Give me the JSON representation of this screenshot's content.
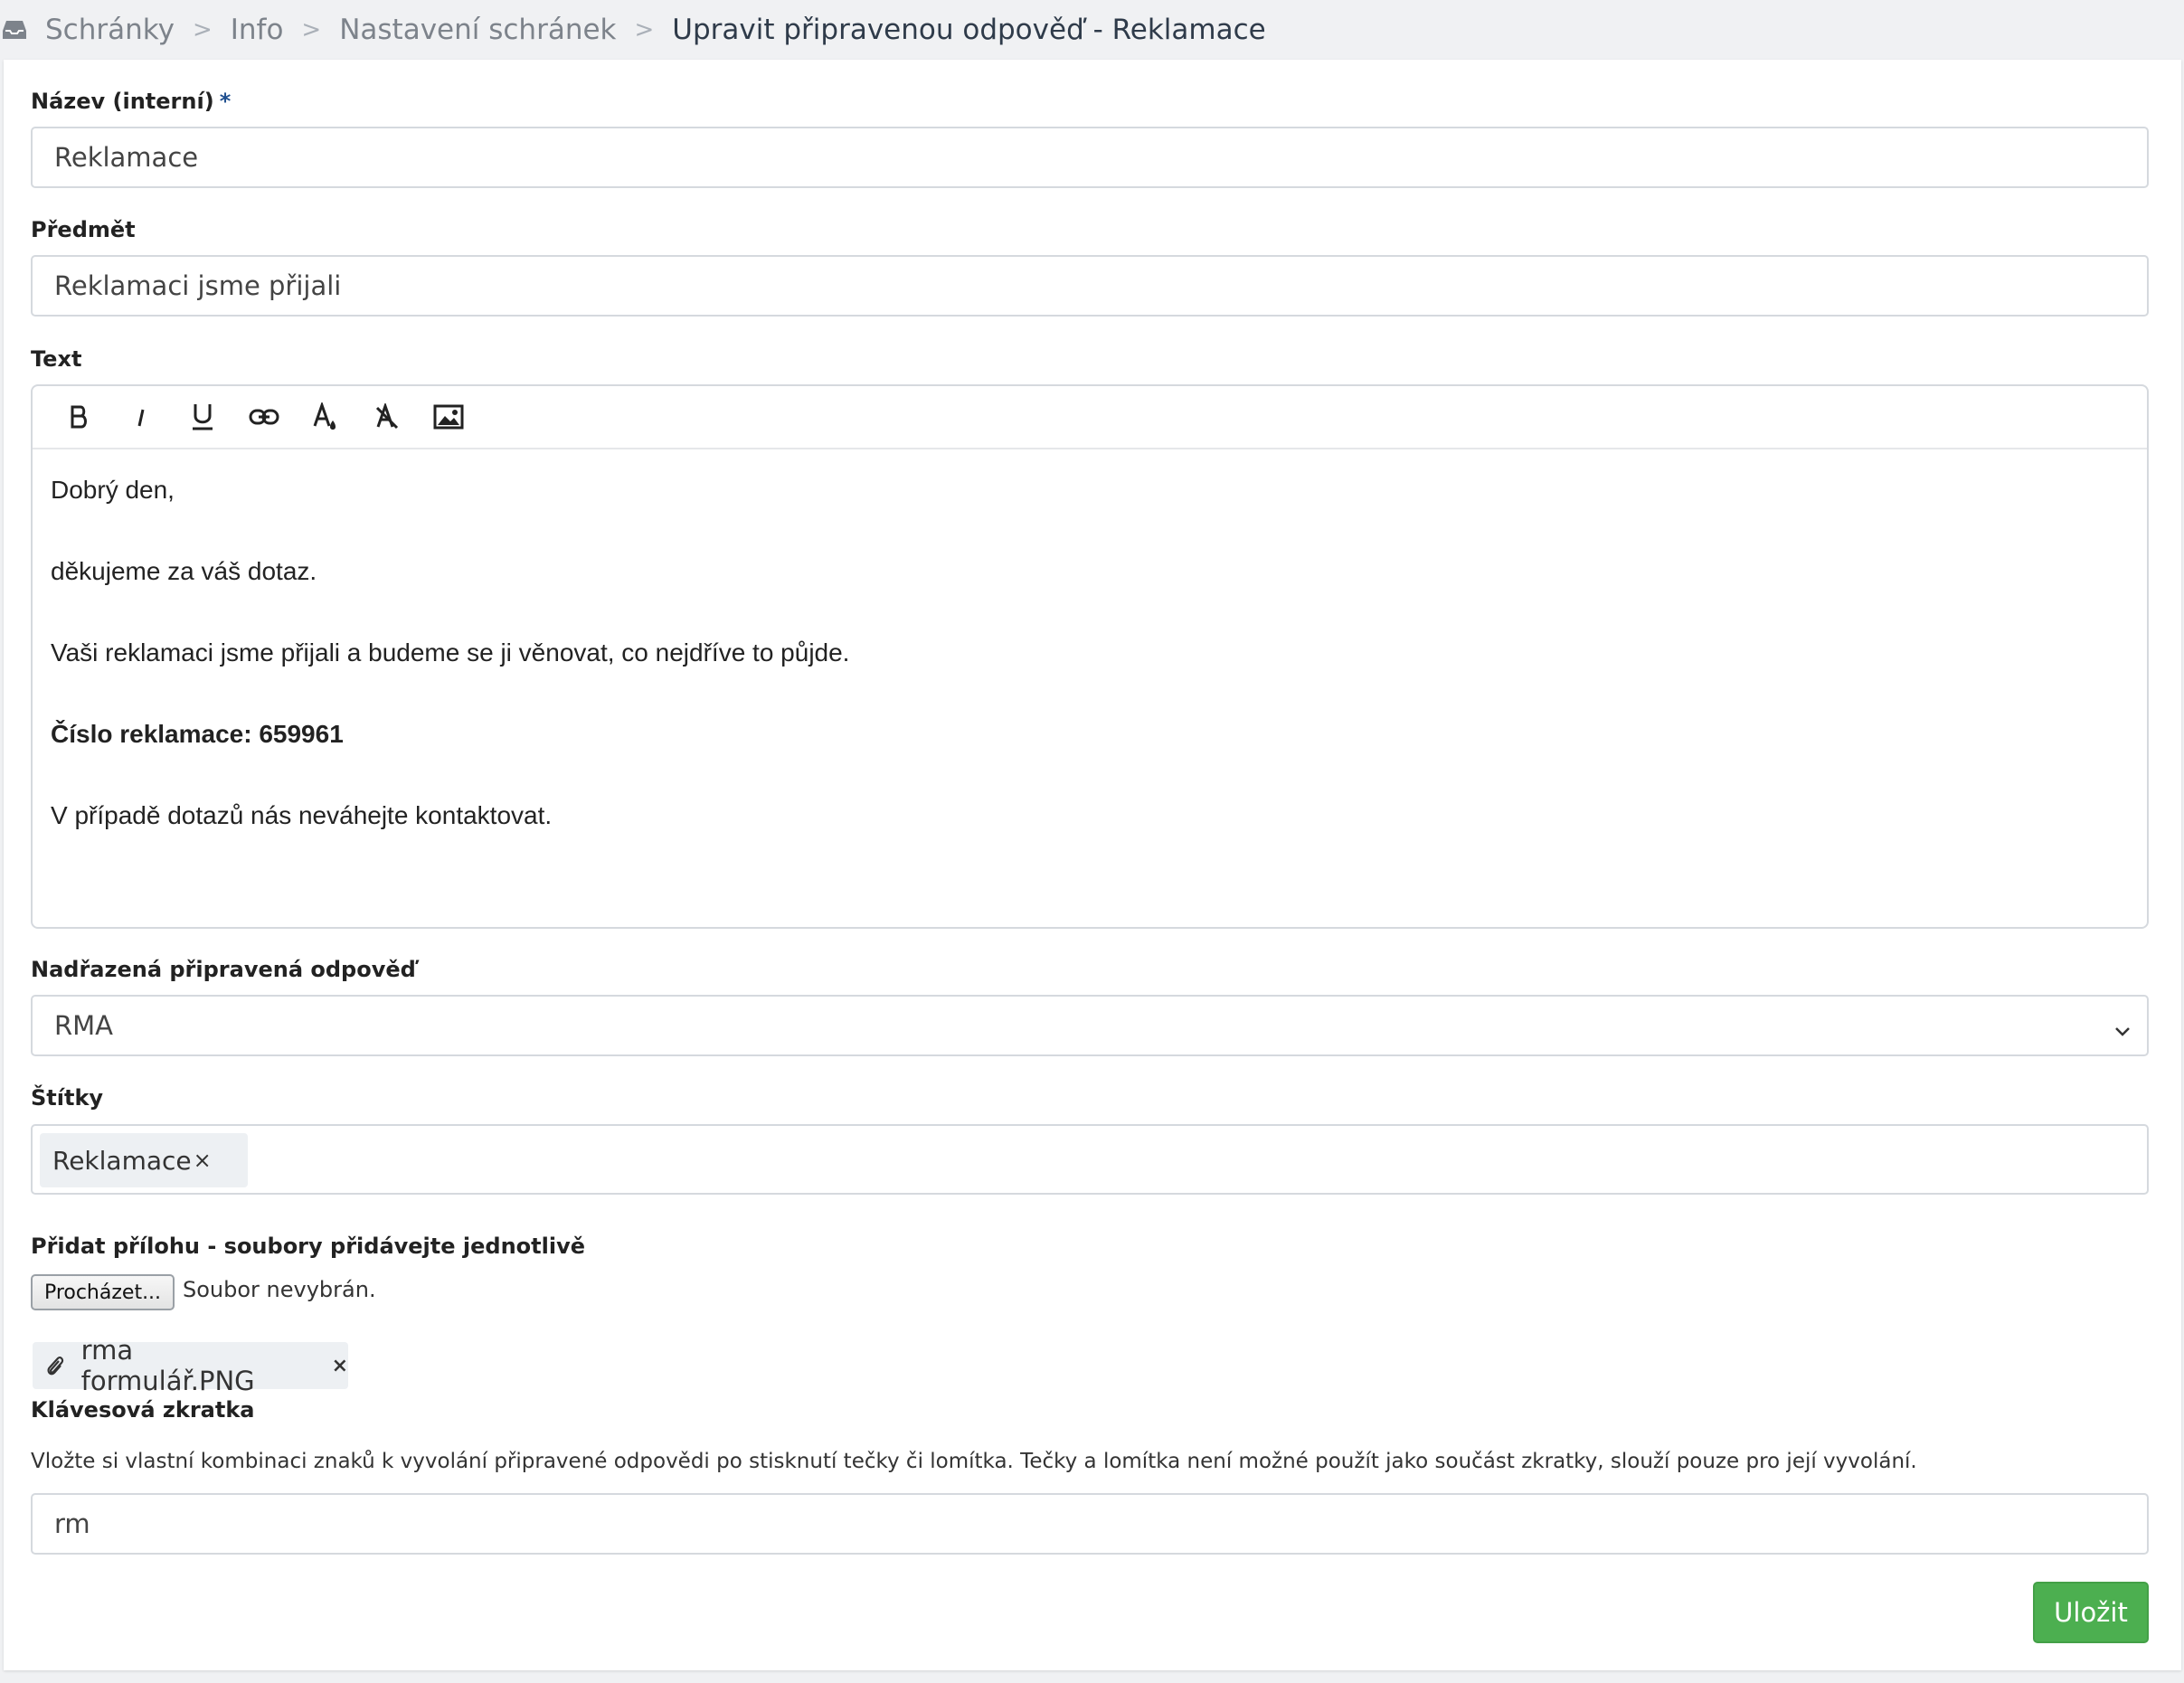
{
  "breadcrumb": {
    "icon": "inbox-icon",
    "items": [
      "Schránky",
      "Info",
      "Nastavení schránek"
    ],
    "separator": ">",
    "current": "Upravit připravenou odpověď - Reklamace"
  },
  "form": {
    "name": {
      "label": "Název (interní)",
      "required_mark": "*",
      "value": "Reklamace"
    },
    "subject": {
      "label": "Předmět",
      "value": "Reklamaci jsme přijali"
    },
    "text": {
      "label": "Text",
      "toolbar": [
        "bold-icon",
        "italic-icon",
        "underline-icon",
        "link-icon",
        "text-color-icon",
        "clear-format-icon",
        "image-icon"
      ],
      "body": [
        "Dobrý den,",
        "děkujeme za váš dotaz.",
        "Vaši reklamaci jsme přijali a budeme se ji věnovat, co nejdříve to půjde.",
        "Číslo reklamace: 659961",
        "V případě dotazů nás neváhejte kontaktovat."
      ]
    },
    "parent": {
      "label": "Nadřazená připravená odpověď",
      "value": "RMA"
    },
    "tags": {
      "label": "Štítky",
      "items": [
        "Reklamace"
      ],
      "remove": "×"
    },
    "attachment": {
      "label": "Přidat přílohu - soubory přidávejte jednotlivě",
      "browse_label": "Procházet...",
      "status": "Soubor nevybrán.",
      "files": [
        "rma formulář.PNG"
      ],
      "remove": "×"
    },
    "shortcut": {
      "label": "Klávesová zkratka",
      "help": "Vložte si vlastní kombinaci znaků k vyvolání připravené odpovědi po stisknutí tečky či lomítka. Tečky a lomítka není možné použít jako součást zkratky, slouží pouze pro její vyvolání.",
      "value": "rm"
    },
    "save_label": "Uložit"
  },
  "colors": {
    "accent": "#4caf50",
    "required": "#1f4f8f"
  }
}
